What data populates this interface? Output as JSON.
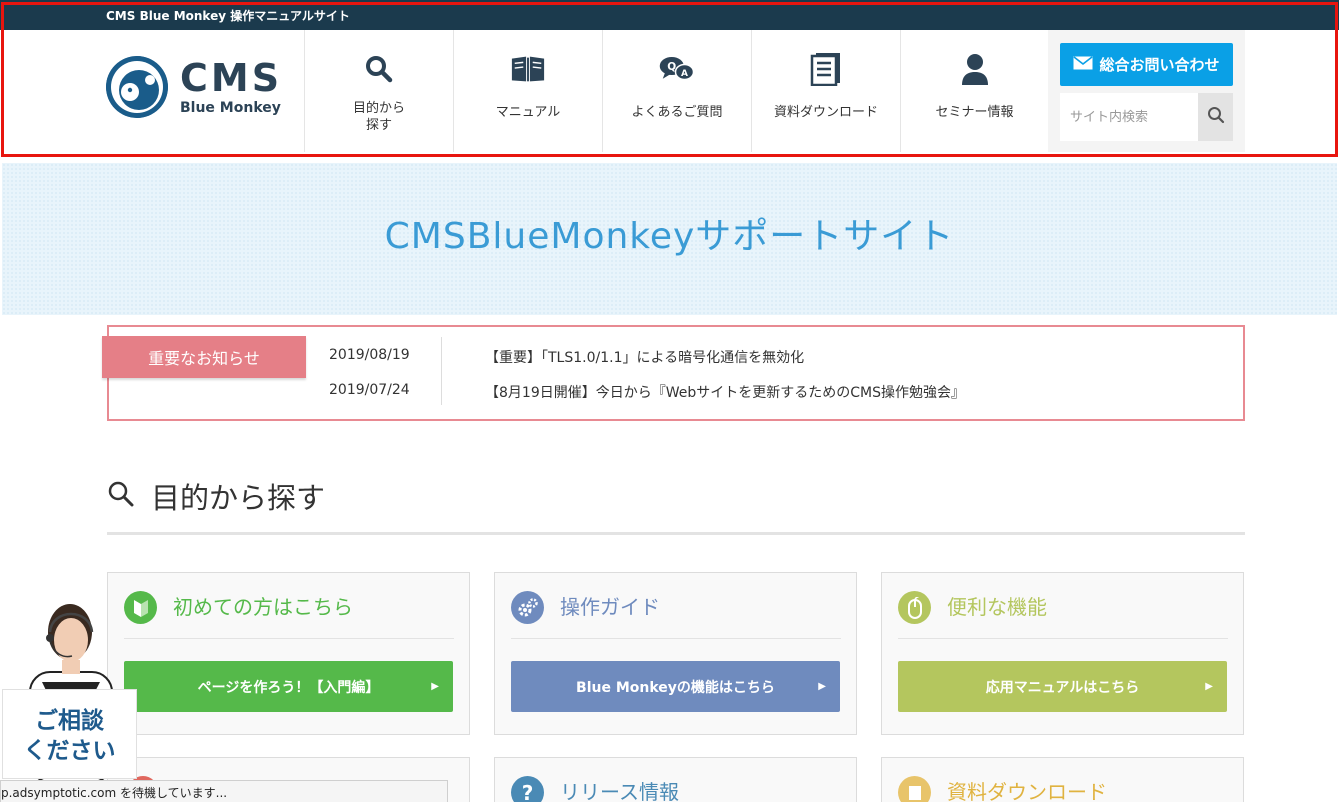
{
  "topbar": {
    "title": "CMS Blue Monkey 操作マニュアルサイト"
  },
  "logo": {
    "main": "CMS",
    "sub": "Blue Monkey"
  },
  "nav": [
    {
      "label": "目的から\n探す",
      "icon": "search-icon"
    },
    {
      "label": "マニュアル",
      "icon": "book-icon"
    },
    {
      "label": "よくあるご質問",
      "icon": "qa-icon"
    },
    {
      "label": "資料ダウンロード",
      "icon": "document-icon"
    },
    {
      "label": "セミナー情報",
      "icon": "person-icon"
    }
  ],
  "header": {
    "contact_label": "総合お問い合わせ",
    "search_placeholder": "サイト内検索"
  },
  "hero": {
    "title": "CMSBlueMonkeyサポートサイト"
  },
  "news": {
    "label": "重要なお知らせ",
    "items": [
      {
        "date": "2019/08/19",
        "text": "【重要】「TLS1.0/1.1」による暗号化通信を無効化"
      },
      {
        "date": "2019/07/24",
        "text": "【8月19日開催】今日から『Webサイトを更新するためのCMS操作勉強会』"
      }
    ]
  },
  "section": {
    "title": "目的から探す"
  },
  "cards": [
    {
      "title": "初めての方はこちら",
      "button": "ページを作ろう！【入門編】",
      "color": "#55b94a",
      "icon": "beginner-leaf-icon"
    },
    {
      "title": "操作ガイド",
      "button": "Blue Monkeyの機能はこちら",
      "color": "#6f8bbe",
      "icon": "gears-icon"
    },
    {
      "title": "便利な機能",
      "button": "応用マニュアルはこちら",
      "color": "#b4c65e",
      "icon": "mouse-icon"
    }
  ],
  "cards_row2": [
    {
      "title": "",
      "icon": "red-icon"
    },
    {
      "title": "リリース情報",
      "icon": "question-icon"
    },
    {
      "title": "資料ダウンロード",
      "icon": "download-icon"
    }
  ],
  "consult": {
    "line1": "ご相談",
    "line2": "ください"
  },
  "status": {
    "text": "p.adsymptotic.com を待機しています..."
  }
}
